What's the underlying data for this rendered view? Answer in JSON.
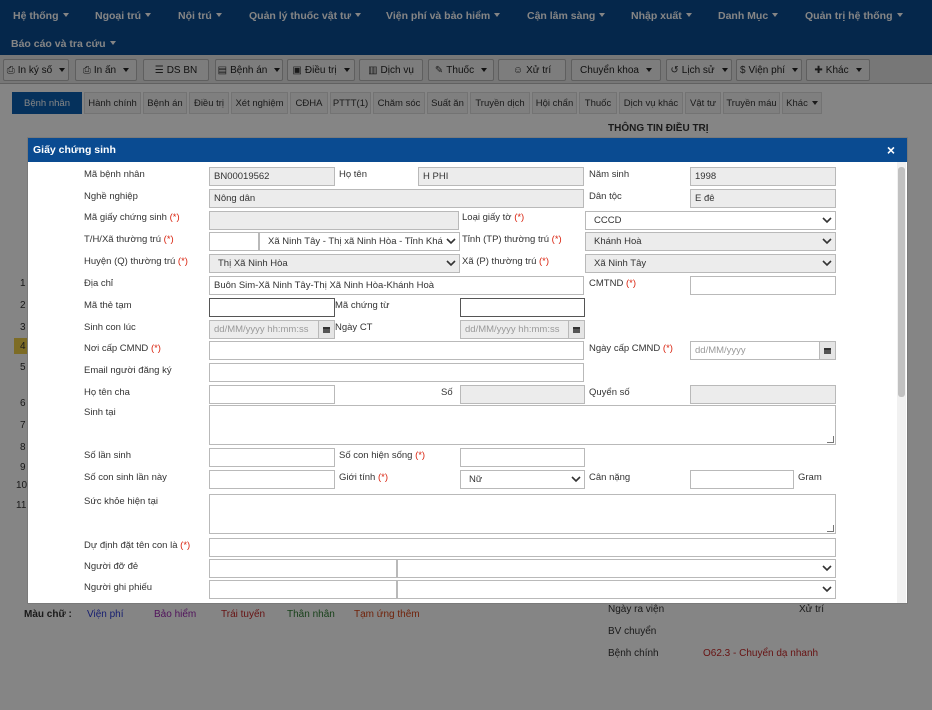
{
  "menu": [
    "Hệ thống",
    "Ngoại trú",
    "Nội trú",
    "Quản lý thuốc vật tư",
    "Viện phí và bảo hiểm",
    "Cận lâm sàng",
    "Nhập xuất",
    "Danh Mục",
    "Quản trị hệ thống",
    "Báo cáo và tra cứu"
  ],
  "toolbar": [
    "In ký số",
    "In ấn",
    "DS BN",
    "Bệnh án",
    "Điều trị",
    "Dịch vụ",
    "Thuốc",
    "Xử trí",
    "Chuyển khoa",
    "Lịch sử",
    "Viện phí",
    "Khác"
  ],
  "tabs": [
    "Bệnh nhân",
    "Hành chính",
    "Bệnh án",
    "Điều trị",
    "Xét nghiệm",
    "CĐHA",
    "PTTT(1)",
    "Chăm sóc",
    "Suất ăn",
    "Truyền dịch",
    "Hội chẩn",
    "Thuốc",
    "Dịch vụ khác",
    "Vật tư",
    "Truyền máu",
    "Khác"
  ],
  "background": {
    "panel_title": "THÔNG TIN ĐIỀU TRỊ",
    "row_numbers": [
      "1",
      "2",
      "3",
      "4",
      "5",
      "6",
      "7",
      "8",
      "9",
      "10",
      "11"
    ],
    "legend_label": "Màu chữ :",
    "legend": [
      "Viện phí",
      "Bảo hiểm",
      "Trái tuyến",
      "Thân nhân",
      "Tạm ứng thêm"
    ],
    "legend_colors": [
      "#2b3bd6",
      "#9b27b0",
      "#c62828",
      "#2e7d32",
      "#d84315"
    ],
    "info": {
      "ngay_ra_vien": "Ngày ra viện",
      "xu_tri": "Xử trí",
      "bv_chuyen": "BV chuyển",
      "benh_chinh": "Bệnh chính",
      "benh_chinh_value": "O62.3 - Chuyển dạ nhanh"
    }
  },
  "dialog": {
    "title": "Giấy chứng sinh",
    "close": "×",
    "labels": {
      "ma_benh_nhan": "Mã bệnh nhân",
      "ho_ten": "Họ tên",
      "nam_sinh": "Năm sinh",
      "nghe_nghiep": "Nghề nghiệp",
      "dan_toc": "Dân tộc",
      "ma_giay_chung_sinh": "Mã giấy chứng sinh",
      "loai_giay_to": "Loại giấy tờ",
      "th_xa_thuong_tru": "T/H/Xã thường trú",
      "tinh_thuong_tru": "Tỉnh (TP) thường trú",
      "huyen_thuong_tru": "Huyện (Q) thường trú",
      "xa_thuong_tru": "Xã (P) thường trú",
      "dia_chi": "Địa chỉ",
      "cmtnd": "CMTND",
      "ma_the_tam": "Mã thẻ tạm",
      "ma_chung_tu": "Mã chứng từ",
      "sinh_con_luc": "Sinh con lúc",
      "ngay_ct": "Ngày CT",
      "noi_cap_cmnd": "Nơi cấp CMND",
      "ngay_cap_cmnd": "Ngày cấp CMND",
      "email": "Email người đăng ký",
      "ho_ten_cha": "Họ tên cha",
      "so": "Số",
      "quyen_so": "Quyển số",
      "sinh_tai": "Sinh tại",
      "so_lan_sinh": "Số lần sinh",
      "so_con_hien_song": "Số con hiện sống",
      "so_con_sinh_lan_nay": "Số con sinh lần này",
      "gioi_tinh": "Giới tính",
      "can_nang": "Cân nặng",
      "gram": "Gram",
      "suc_khoe": "Sức khỏe hiện tại",
      "du_dinh_ten": "Dự định đặt tên con là",
      "nguoi_do_de": "Người đỡ đẻ",
      "nguoi_ghi_phieu": "Người ghi phiếu"
    },
    "required_mark": "(*)",
    "values": {
      "ma_benh_nhan": "BN00019562",
      "ho_ten": "H PHI",
      "nam_sinh": "1998",
      "nghe_nghiep": "Nông dân",
      "dan_toc": "E đê",
      "loai_giay_to": "CCCD",
      "th_xa_thuong_tru": "Xã Ninh Tây - Thị xã Ninh Hòa - Tỉnh Khá",
      "tinh_thuong_tru": "Khánh Hoà",
      "huyen_thuong_tru": "Thị Xã Ninh Hòa",
      "xa_thuong_tru": "Xã Ninh Tây",
      "dia_chi": "Buôn Sim-Xã Ninh Tây-Thị Xã Ninh Hòa-Khánh Hoà",
      "gioi_tinh": "Nữ"
    },
    "placeholders": {
      "datetime": "dd/MM/yyyy hh:mm:ss",
      "date": "dd/MM/yyyy"
    }
  }
}
